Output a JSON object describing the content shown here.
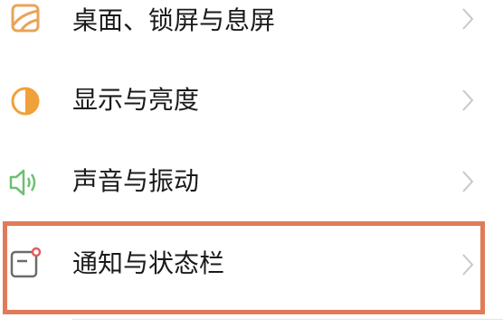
{
  "settings": {
    "items": [
      {
        "label": "桌面、锁屏与息屏",
        "icon": "wallpaper-icon"
      },
      {
        "label": "显示与亮度",
        "icon": "brightness-icon"
      },
      {
        "label": "声音与振动",
        "icon": "speaker-icon"
      },
      {
        "label": "通知与状态栏",
        "icon": "notification-icon"
      }
    ]
  },
  "highlight": {
    "target": "通知与状态栏",
    "color": "#E07B59"
  },
  "colors": {
    "wallpaper_icon": "#E8A458",
    "brightness_icon": "#F0A13A",
    "speaker_icon": "#6FBF73",
    "notification_icon": "#6B6B6B",
    "notification_dot": "#E35D5D",
    "chevron": "#C8C8C8"
  }
}
